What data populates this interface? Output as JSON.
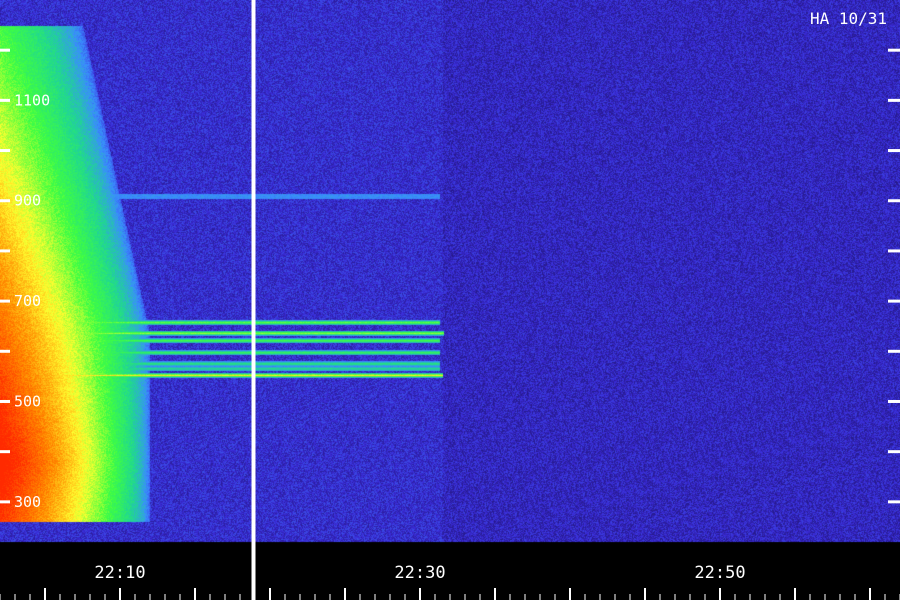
{
  "corner_label": "HA 10/31",
  "chart_data": {
    "type": "heatmap",
    "title": "",
    "xlabel": "",
    "ylabel": "",
    "x_range": [
      "22:02",
      "22:62"
    ],
    "y_range": [
      220,
      1300
    ],
    "y_ticks": [
      {
        "value": 1100,
        "label": "1100"
      },
      {
        "value": 900,
        "label": "900"
      },
      {
        "value": 700,
        "label": "700"
      },
      {
        "value": 500,
        "label": "500"
      },
      {
        "value": 300,
        "label": "300"
      }
    ],
    "y_minor_ticks": [
      1200,
      1000,
      800,
      600,
      400
    ],
    "x_ticks": [
      {
        "value": "22:10",
        "label": "22:10"
      },
      {
        "value": "22:30",
        "label": "22:30"
      },
      {
        "value": "22:50",
        "label": "22:50"
      }
    ],
    "x_minor_tick_step_min": 5,
    "x_minor_sub_step_min": 1,
    "colormap": [
      "#1a0f5e",
      "#3a2bd8",
      "#3a8cff",
      "#20d890",
      "#40ff40",
      "#ffff30",
      "#ff8a00",
      "#ff2a00"
    ],
    "cursor_time": "22:18.9",
    "burst": {
      "start_time": "22:02",
      "end_time": "22:12",
      "freq_low": 260,
      "freq_high": 1250,
      "peak_freq": 380
    },
    "lines": [
      {
        "freq": 658,
        "end_time": "22:31.3",
        "intensity": 0.62
      },
      {
        "freq": 637,
        "end_time": "22:31.6",
        "intensity": 0.72
      },
      {
        "freq": 622,
        "end_time": "22:31.3",
        "intensity": 0.58
      },
      {
        "freq": 598,
        "end_time": "22:31.3",
        "intensity": 0.5
      },
      {
        "freq": 576,
        "end_time": "22:31.3",
        "intensity": 0.38
      },
      {
        "freq": 566,
        "end_time": "22:31.3",
        "intensity": 0.32
      },
      {
        "freq": 553,
        "end_time": "22:31.5",
        "intensity": 0.9
      }
    ],
    "faint_band": {
      "freq_low": 905,
      "freq_high": 915,
      "end_time": "22:31.3"
    },
    "background_step_time": "22:31.5"
  }
}
